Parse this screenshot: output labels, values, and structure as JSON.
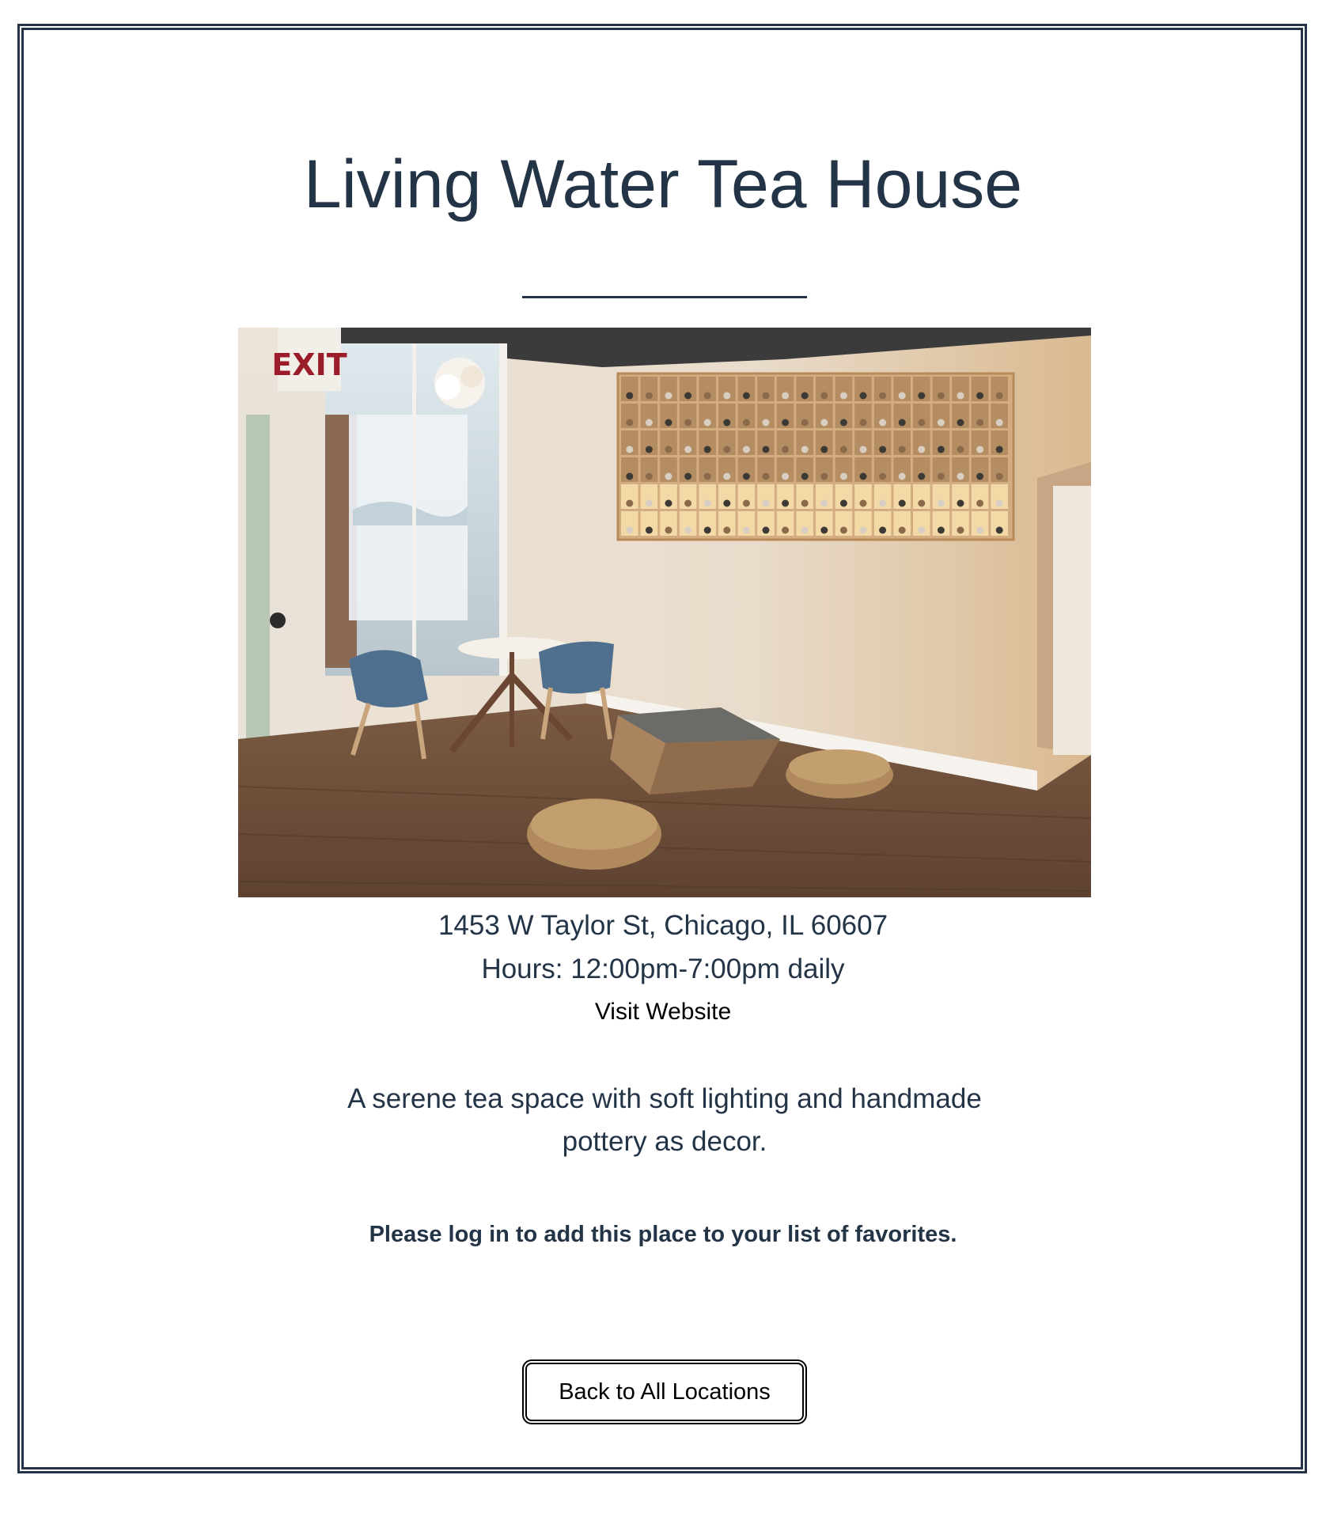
{
  "place": {
    "name": "Living Water Tea House",
    "address": "1453 W Taylor St, Chicago, IL 60607",
    "hours": "Hours: 12:00pm-7:00pm daily",
    "website_label": "Visit Website",
    "description": "A serene tea space with soft lighting and handmade pottery as decor.",
    "login_note": "Please log in to add this place to your list of favorites.",
    "photo_exit_sign": "EXIT"
  },
  "navigation": {
    "back_label": "Back to All Locations"
  },
  "colors": {
    "text": "#243447",
    "border": "#243447",
    "background": "#ffffff",
    "link": "#000000"
  }
}
